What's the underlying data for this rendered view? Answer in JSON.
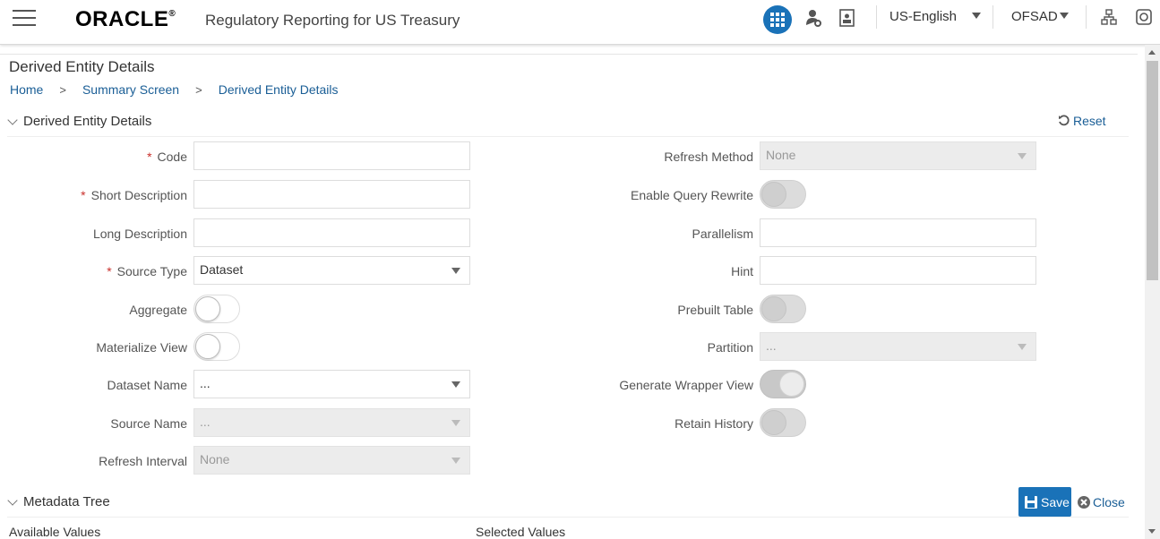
{
  "header": {
    "logo_text": "ORACLE",
    "app_title": "Regulatory Reporting for US Treasury",
    "language": "US-English",
    "user": "OFSAD",
    "icons": [
      "menu-icon",
      "apps-grid-icon",
      "user-settings-icon",
      "document-icon",
      "sitemap-icon",
      "help-icon"
    ]
  },
  "page": {
    "title": "Derived Entity Details",
    "breadcrumb": [
      "Home",
      "Summary Screen",
      "Derived Entity Details"
    ]
  },
  "section": {
    "title": "Derived Entity Details",
    "reset_label": "Reset"
  },
  "form_left": {
    "code_label": "Code",
    "code_value": "",
    "short_desc_label": "Short Description",
    "short_desc_value": "",
    "long_desc_label": "Long Description",
    "long_desc_value": "",
    "source_type_label": "Source Type",
    "source_type_value": "Dataset",
    "aggregate_label": "Aggregate",
    "materialize_label": "Materialize View",
    "dataset_name_label": "Dataset Name",
    "dataset_name_value": "...",
    "source_name_label": "Source Name",
    "source_name_value": "...",
    "refresh_interval_label": "Refresh Interval",
    "refresh_interval_value": "None"
  },
  "form_right": {
    "refresh_method_label": "Refresh Method",
    "refresh_method_value": "None",
    "query_rewrite_label": "Enable Query Rewrite",
    "parallelism_label": "Parallelism",
    "parallelism_value": "",
    "hint_label": "Hint",
    "hint_value": "",
    "prebuilt_label": "Prebuilt Table",
    "partition_label": "Partition",
    "partition_value": "...",
    "wrapper_label": "Generate Wrapper View",
    "retain_label": "Retain History"
  },
  "metadata": {
    "title": "Metadata Tree",
    "save_label": "Save",
    "close_label": "Close",
    "available_label": "Available Values",
    "selected_label": "Selected Values"
  },
  "colors": {
    "accent": "#1a72b8",
    "link": "#1a5e96",
    "required": "#c9302c"
  }
}
